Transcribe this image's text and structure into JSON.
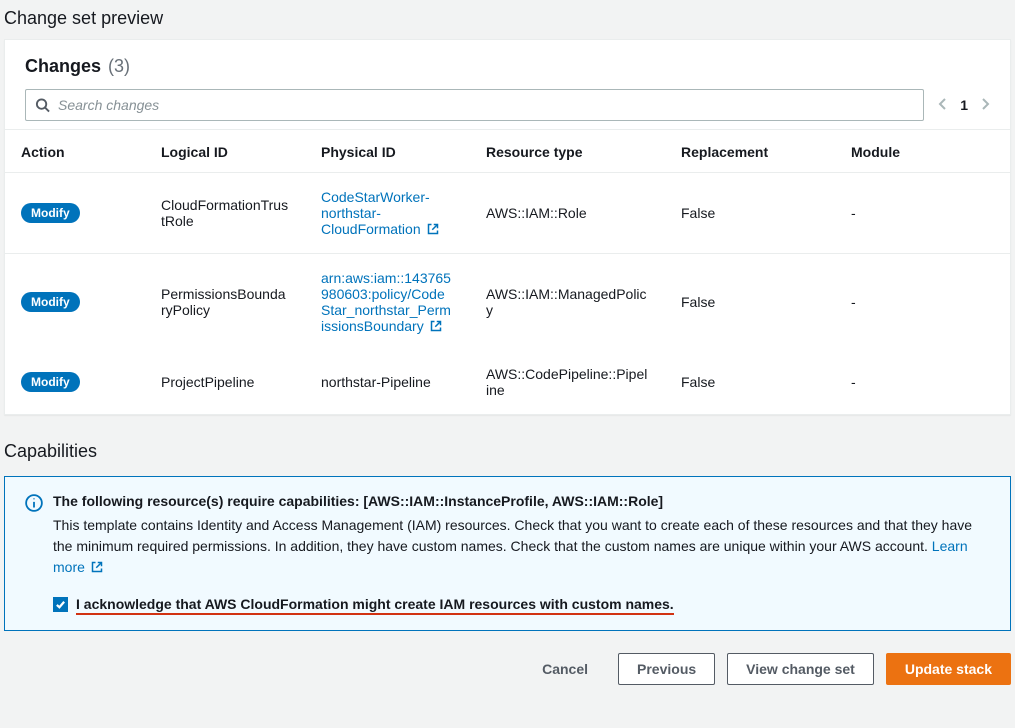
{
  "page_title": "Change set preview",
  "changes_panel": {
    "heading": "Changes",
    "count_display": "(3)",
    "search_placeholder": "Search changes",
    "page_current": "1",
    "columns": {
      "action": "Action",
      "logical": "Logical ID",
      "physical": "Physical ID",
      "resource": "Resource type",
      "replacement": "Replacement",
      "module": "Module"
    },
    "rows": [
      {
        "action": "Modify",
        "logical": "CloudFormationTrustRole",
        "physical": "CodeStarWorker-northstar-CloudFormation",
        "physical_is_link": true,
        "resource": "AWS::IAM::Role",
        "replacement": "False",
        "module": "-"
      },
      {
        "action": "Modify",
        "logical": "PermissionsBoundaryPolicy",
        "physical": "arn:aws:iam::143765980603:policy/CodeStar_northstar_PermissionsBoundary",
        "physical_is_link": true,
        "resource": "AWS::IAM::ManagedPolicy",
        "replacement": "False",
        "module": "-"
      },
      {
        "action": "Modify",
        "logical": "ProjectPipeline",
        "physical": "northstar-Pipeline",
        "physical_is_link": false,
        "resource": "AWS::CodePipeline::Pipeline",
        "replacement": "False",
        "module": "-"
      }
    ]
  },
  "capabilities": {
    "title": "Capabilities",
    "info_title": "The following resource(s) require capabilities: [AWS::IAM::InstanceProfile, AWS::IAM::Role]",
    "info_body": "This template contains Identity and Access Management (IAM) resources. Check that you want to create each of these resources and that they have the minimum required permissions. In addition, they have custom names. Check that the custom names are unique within your AWS account. ",
    "learn_more": "Learn more",
    "ack_label": "I acknowledge that AWS CloudFormation might create IAM resources with custom names.",
    "ack_checked": true
  },
  "footer": {
    "cancel": "Cancel",
    "previous": "Previous",
    "view": "View change set",
    "update": "Update stack"
  }
}
